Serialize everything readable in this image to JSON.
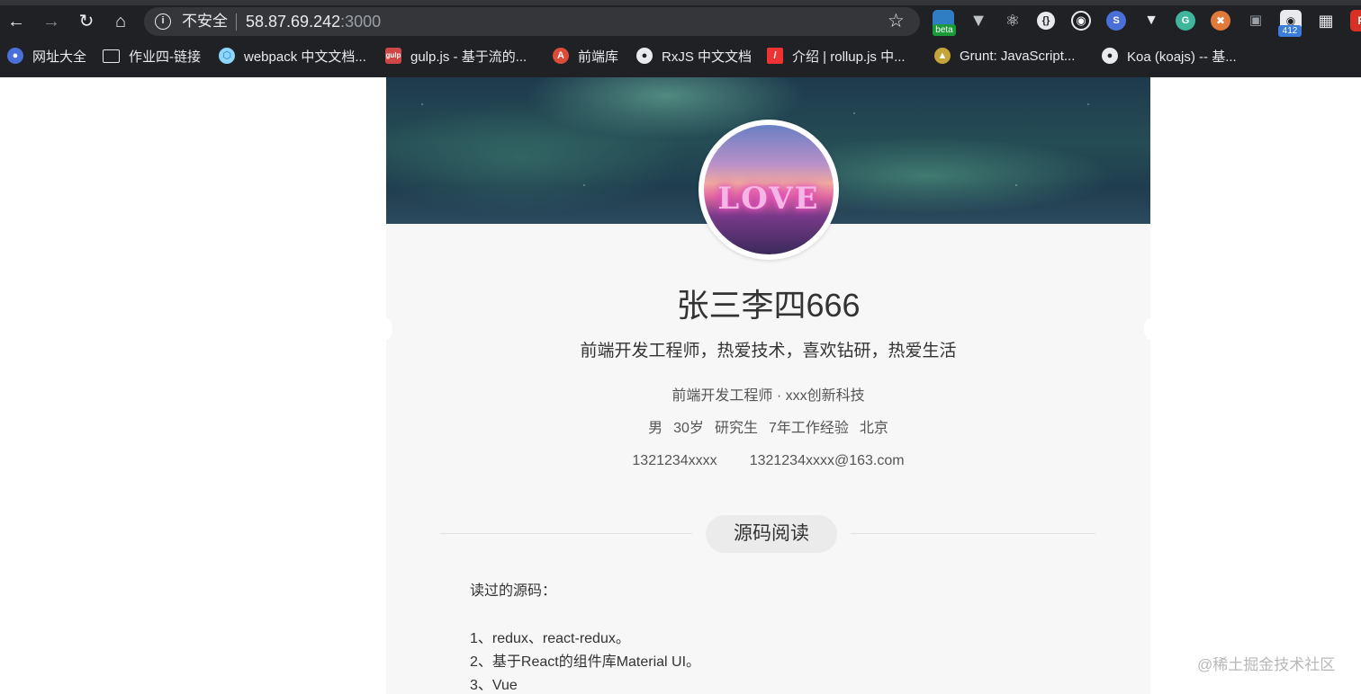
{
  "browser": {
    "insecure_label": "不安全",
    "url_host": "58.87.69.242",
    "url_port": ":3000",
    "extensions": {
      "beta_badge": "beta",
      "count_badge": "412"
    },
    "bookmarks": [
      {
        "label": "网址大全",
        "icon": "globe-icon"
      },
      {
        "label": "作业四-链接",
        "icon": "folder-icon"
      },
      {
        "label": "webpack 中文文档...",
        "icon": "webpack-icon"
      },
      {
        "label": "gulp.js - 基于流的...",
        "icon": "gulp-icon"
      },
      {
        "label": "前端库",
        "icon": "angular-icon"
      },
      {
        "label": "RxJS 中文文档",
        "icon": "globe-icon"
      },
      {
        "label": "介绍 | rollup.js 中...",
        "icon": "rollup-icon"
      },
      {
        "label": "Grunt: JavaScript...",
        "icon": "grunt-icon"
      },
      {
        "label": "Koa (koajs) -- 基...",
        "icon": "globe-icon"
      }
    ],
    "colors": {
      "chrome_bg": "#202124",
      "omnibox_bg": "#35363a",
      "text": "#e8eaed"
    }
  },
  "profile": {
    "name": "张三李四666",
    "motto": "前端开发工程师，热爱技术，喜欢钻研，热爱生活",
    "job_line": "前端开发工程师 · xxx创新科技",
    "details": [
      "男",
      "30岁",
      "研究生",
      "7年工作经验",
      "北京"
    ],
    "phone": "1321234xxxx",
    "email": "1321234xxxx@163.com",
    "avatar_text": "LOVE"
  },
  "section": {
    "title": "源码阅读",
    "intro": "读过的源码：",
    "items": [
      "1、redux、react-redux。",
      "2、基于React的组件库Material UI。",
      "3、Vue"
    ]
  },
  "watermark": "@稀土掘金技术社区"
}
